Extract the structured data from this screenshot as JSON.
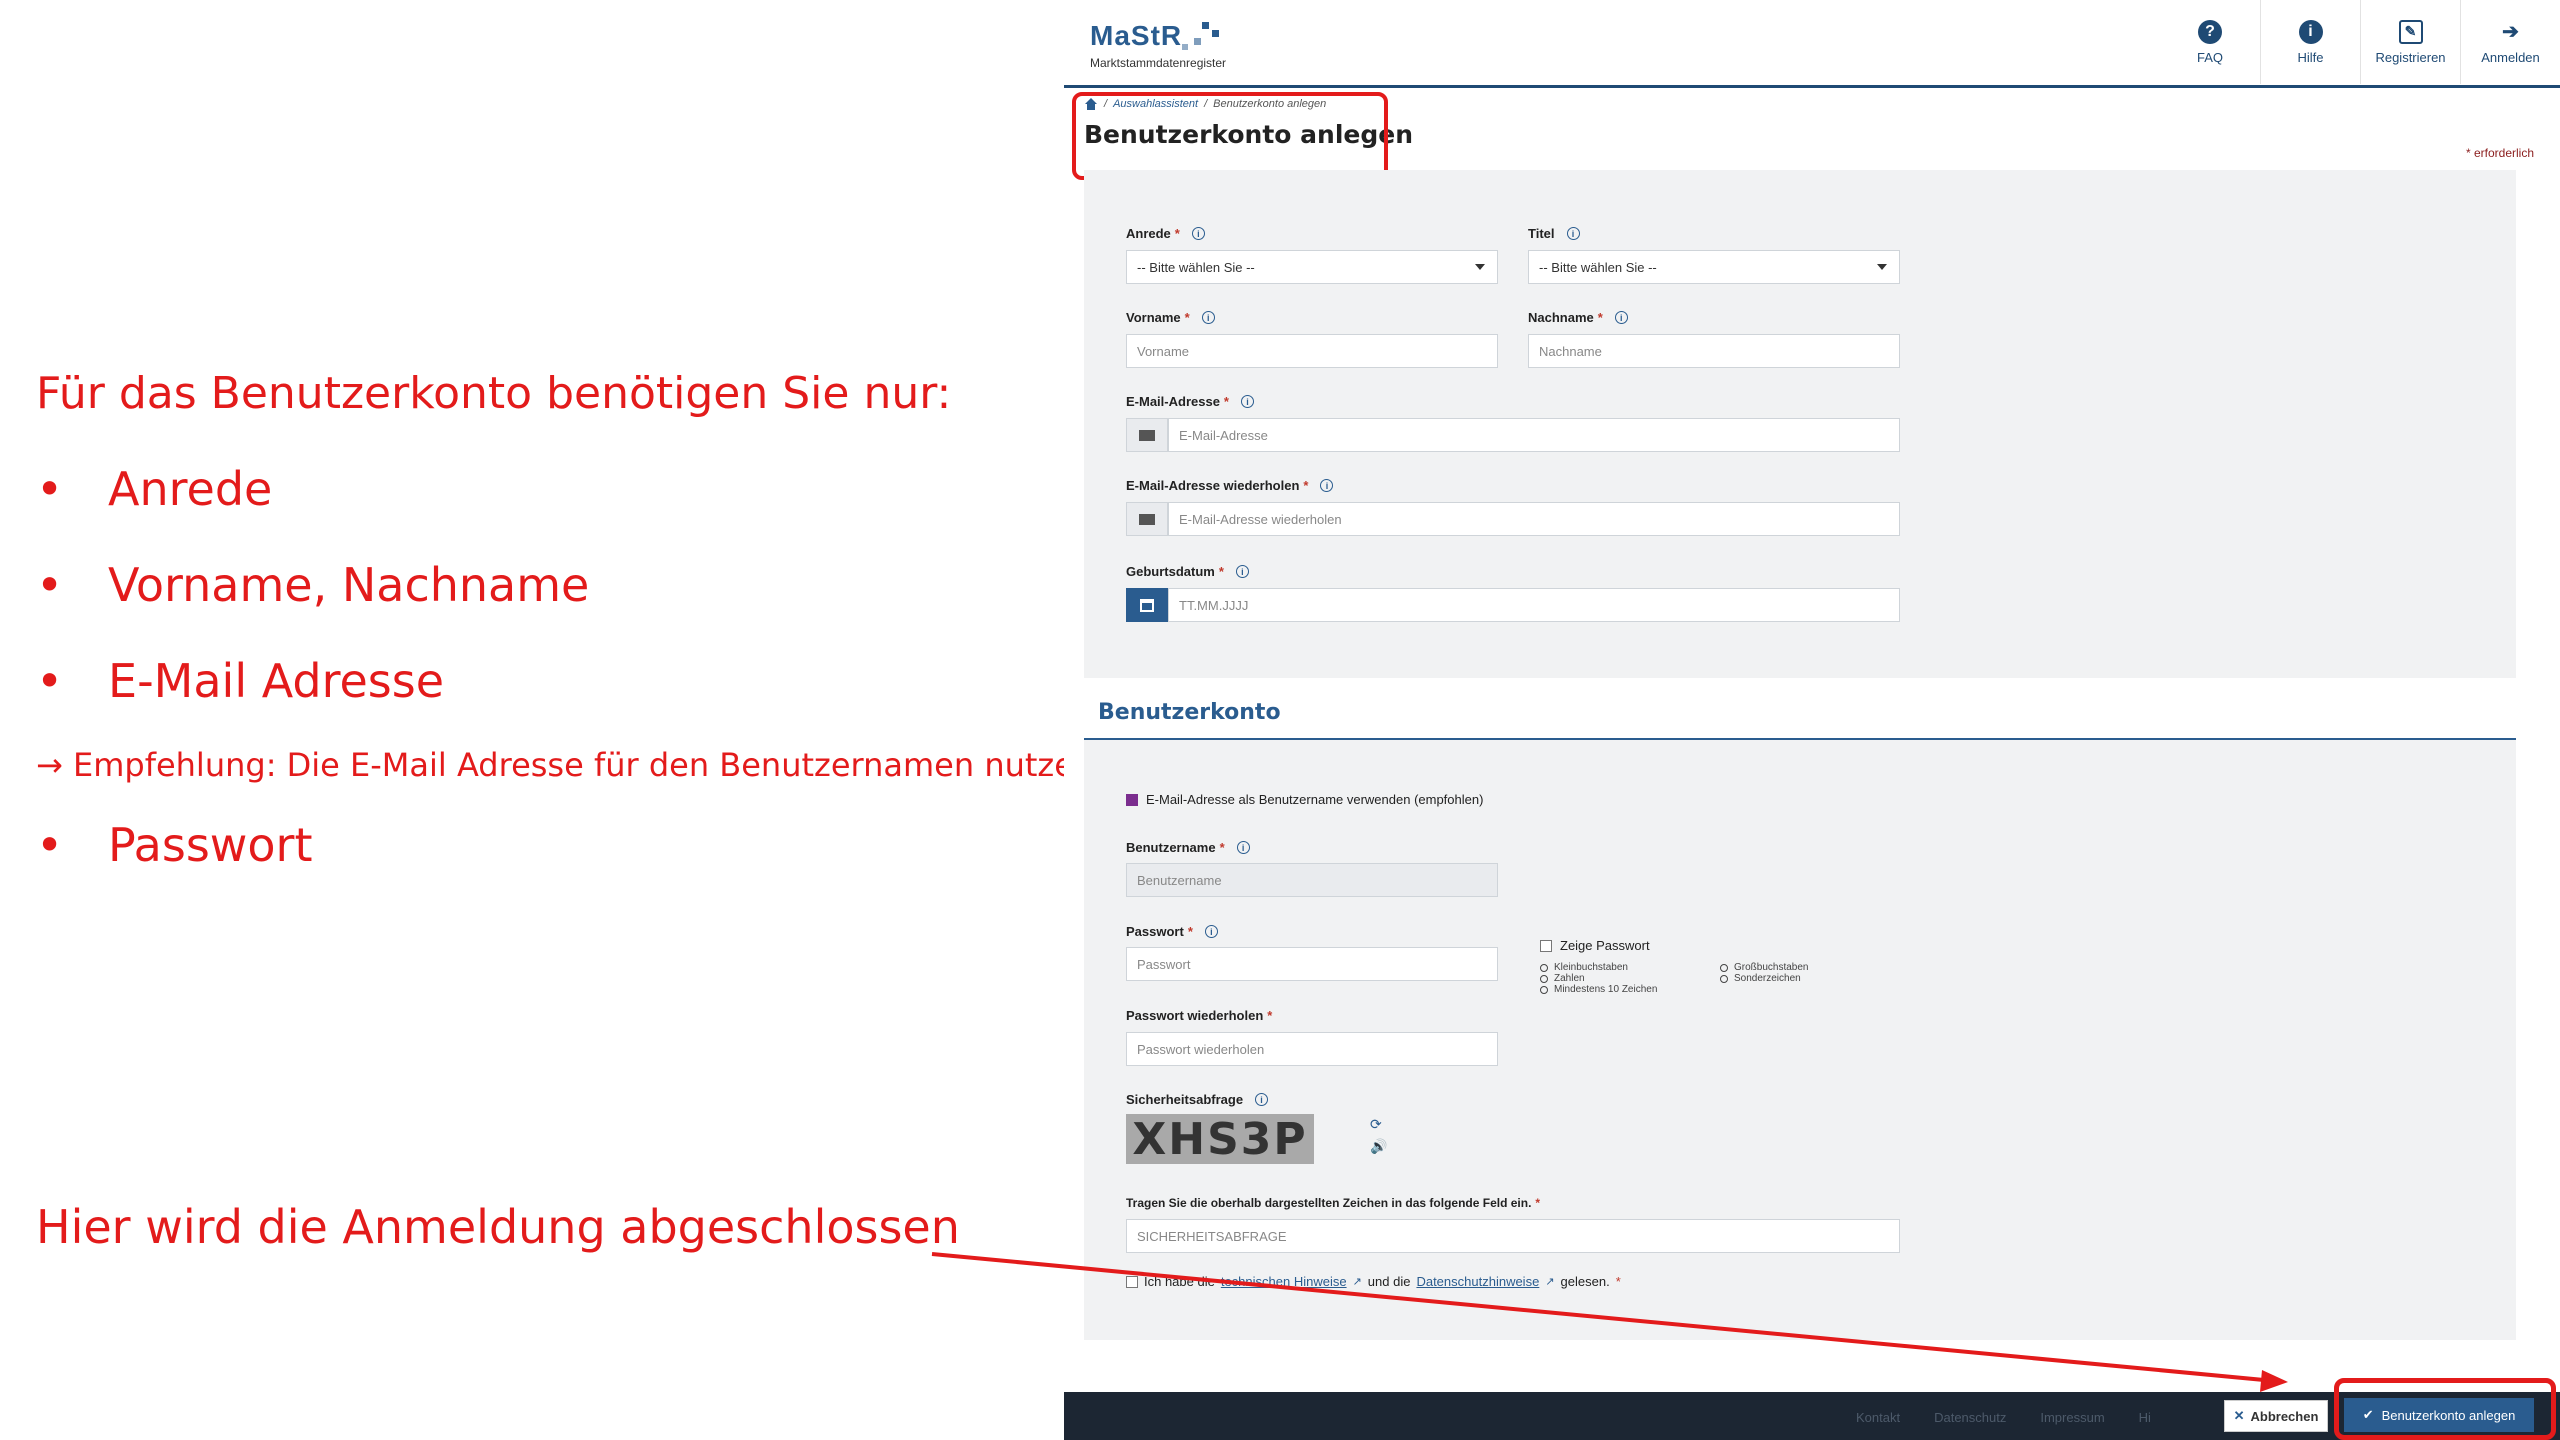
{
  "annotation": {
    "intro": "Für das Benutzerkonto benötigen Sie nur:",
    "bullets": [
      "Anrede",
      "Vorname, Nachname",
      "E-Mail Adresse",
      "Passwort"
    ],
    "bullet_symbol": "•",
    "recommendation": "→ Empfehlung: Die E-Mail Adresse für den Benutzernamen nutzen",
    "finish": "Hier wird die Anmeldung abgeschlossen",
    "color": "#e31b1b"
  },
  "header": {
    "logo_text": "MaStR",
    "logo_sub": "Marktstammdatenregister",
    "nav": [
      {
        "label": "FAQ",
        "icon": "question-icon",
        "glyph": "?"
      },
      {
        "label": "Hilfe",
        "icon": "info-icon",
        "glyph": "i"
      },
      {
        "label": "Registrieren",
        "icon": "edit-icon",
        "glyph": "✎"
      },
      {
        "label": "Anmelden",
        "icon": "login-icon",
        "glyph": "➔"
      }
    ]
  },
  "breadcrumb": {
    "separator": "/",
    "items": [
      "Auswahlassistent",
      "Benutzerkonto anlegen"
    ]
  },
  "page_title": "Benutzerkonto anlegen",
  "required_note": "* erforderlich",
  "form": {
    "anrede": {
      "label": "Anrede",
      "value": "-- Bitte wählen Sie --"
    },
    "titel": {
      "label": "Titel",
      "value": "-- Bitte wählen Sie --"
    },
    "vorname": {
      "label": "Vorname",
      "placeholder": "Vorname"
    },
    "nachname": {
      "label": "Nachname",
      "placeholder": "Nachname"
    },
    "email": {
      "label": "E-Mail-Adresse",
      "placeholder": "E-Mail-Adresse"
    },
    "email_repeat": {
      "label": "E-Mail-Adresse wiederholen",
      "placeholder": "E-Mail-Adresse wiederholen"
    },
    "geburtsdatum": {
      "label": "Geburtsdatum",
      "placeholder": "TT.MM.JJJJ"
    }
  },
  "account": {
    "section_title": "Benutzerkonto",
    "use_email_checkbox": "E-Mail-Adresse als Benutzername verwenden (empfohlen)",
    "benutzername": {
      "label": "Benutzername",
      "placeholder": "Benutzername"
    },
    "passwort": {
      "label": "Passwort",
      "placeholder": "Passwort"
    },
    "show_password": "Zeige Passwort",
    "pw_rules_left": [
      "Kleinbuchstaben",
      "Zahlen",
      "Mindestens 10 Zeichen"
    ],
    "pw_rules_right": [
      "Großbuchstaben",
      "Sonderzeichen"
    ],
    "passwort_repeat": {
      "label": "Passwort wiederholen",
      "placeholder": "Passwort wiederholen"
    },
    "captcha_label": "Sicherheitsabfrage",
    "captcha_text": "XHS3P",
    "captcha_instruction": "Tragen Sie die oberhalb dargestellten Zeichen in das folgende Feld ein.",
    "captcha_input": {
      "placeholder": "SICHERHEITSABFRAGE"
    },
    "terms": {
      "pre": "Ich habe die",
      "link1": "technischen Hinweise",
      "mid": "und die",
      "link2": "Datenschutzhinweise",
      "post": "gelesen."
    }
  },
  "footer": {
    "links": [
      "Kontakt",
      "Datenschutz",
      "Impressum",
      "Hi"
    ],
    "cancel": "Abbrechen",
    "submit": "Benutzerkonto anlegen"
  }
}
